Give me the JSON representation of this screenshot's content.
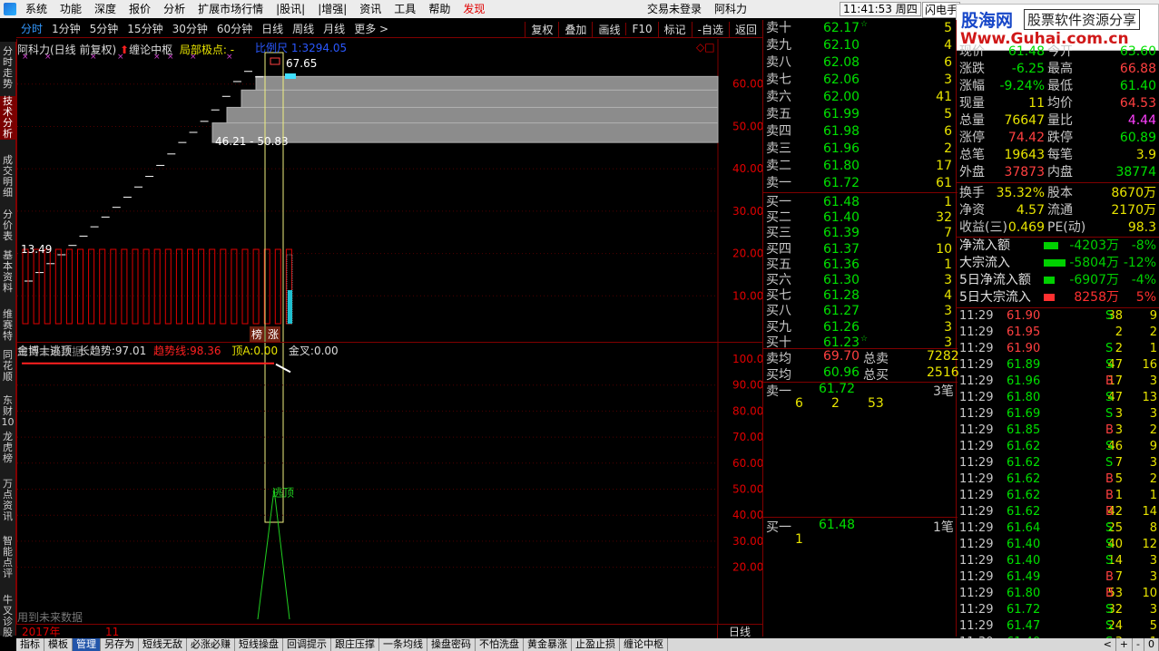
{
  "menu": {
    "items": [
      "系统",
      "功能",
      "深度",
      "报价",
      "分析",
      "扩展市场行情",
      "|股讯|",
      "|增强|",
      "资讯",
      "工具",
      "帮助"
    ],
    "discover": "发现",
    "login_status": "交易未登录",
    "stock_name": "阿科力",
    "clock": "11:41:53 周四",
    "flash_btn": "闪电手"
  },
  "watermark": {
    "brand": "股海网",
    "slogan": "股票软件资源分享",
    "url": "Www.Guhai.com.cn"
  },
  "periods": [
    "分时",
    "1分钟",
    "5分钟",
    "15分钟",
    "30分钟",
    "60分钟",
    "日线",
    "周线",
    "月线",
    "更多 >"
  ],
  "period_selected": 0,
  "tools": [
    "复权",
    "叠加",
    "画线",
    "F10",
    "标记",
    "-自选",
    "返回"
  ],
  "left_tabs": [
    "分时走势",
    "技术分析",
    "成交明细",
    "分价表",
    "基本资料",
    "维赛特",
    "同花顺",
    "东财10",
    "龙虎榜",
    "万点资讯",
    "智能点评",
    "牛叉诊股"
  ],
  "left_tab_selected": 1,
  "main_chart": {
    "title": "阿科力(日线 前复权)",
    "indicator": "缠论中枢",
    "extra_label": "局部极点: -",
    "header_blue": "比例尺 1:3294.05",
    "high_label": "67.65",
    "range_label": "46.21 - 50.83",
    "low_label": "13.49",
    "future_data_note": "用到未来数据",
    "badges": [
      "榜",
      "涨"
    ],
    "y_ticks": [
      "60.00",
      "50.00",
      "40.00",
      "30.00",
      "20.00",
      "10.00"
    ]
  },
  "chart_data": {
    "type": "bar",
    "step_prices": [
      13.49,
      15.5,
      17.6,
      19.7,
      21.9,
      24.1,
      26.3,
      28.6,
      30.9,
      33.3,
      35.7,
      38.2,
      40.8,
      43.5,
      46.21,
      48.6,
      51.2,
      53.9,
      57.1,
      60.6,
      63.0,
      61.7
    ],
    "volume_bars": 25,
    "zhongshu_zones": [
      [
        46.21,
        50.83
      ],
      [
        50.83,
        54.5
      ],
      [
        54.5,
        58.6
      ],
      [
        58.6,
        61.8
      ]
    ],
    "y_range": [
      0,
      67.65
    ]
  },
  "sub_chart": {
    "title": "金博士逃顶",
    "long_trend_label": "长趋势:",
    "long_trend_value": "97.01",
    "trend_line_label": "趋势线:",
    "trend_line_value": "98.36",
    "top_a_label": "顶A:",
    "top_a_value": "0.00",
    "golden_cross_label": "金叉:",
    "golden_cross_value": "0.00",
    "escape_label": "逃顶",
    "future_data_note": "用到未来数据",
    "y_ticks": [
      "100.0",
      "90.00",
      "80.00",
      "70.00",
      "60.00",
      "50.00",
      "40.00",
      "30.00",
      "20.00"
    ],
    "spike_value": 50
  },
  "date_bar": {
    "year": "2017年",
    "month": "11",
    "period": "日线"
  },
  "order_book": {
    "asks": [
      {
        "label": "卖十",
        "price": "62.17",
        "vol": "5",
        "flag": "☆"
      },
      {
        "label": "卖九",
        "price": "62.10",
        "vol": "4",
        "flag": ""
      },
      {
        "label": "卖八",
        "price": "62.08",
        "vol": "6",
        "flag": ""
      },
      {
        "label": "卖七",
        "price": "62.06",
        "vol": "3",
        "flag": ""
      },
      {
        "label": "卖六",
        "price": "62.00",
        "vol": "41",
        "flag": ""
      },
      {
        "label": "卖五",
        "price": "61.99",
        "vol": "5",
        "flag": ""
      },
      {
        "label": "卖四",
        "price": "61.98",
        "vol": "6",
        "flag": ""
      },
      {
        "label": "卖三",
        "price": "61.96",
        "vol": "2",
        "flag": ""
      },
      {
        "label": "卖二",
        "price": "61.80",
        "vol": "17",
        "flag": ""
      },
      {
        "label": "卖一",
        "price": "61.72",
        "vol": "61",
        "flag": ""
      }
    ],
    "bids": [
      {
        "label": "买一",
        "price": "61.48",
        "vol": "1",
        "flag": ""
      },
      {
        "label": "买二",
        "price": "61.40",
        "vol": "32",
        "flag": ""
      },
      {
        "label": "买三",
        "price": "61.39",
        "vol": "7",
        "flag": ""
      },
      {
        "label": "买四",
        "price": "61.37",
        "vol": "10",
        "flag": ""
      },
      {
        "label": "买五",
        "price": "61.36",
        "vol": "1",
        "flag": ""
      },
      {
        "label": "买六",
        "price": "61.30",
        "vol": "3",
        "flag": ""
      },
      {
        "label": "买七",
        "price": "61.28",
        "vol": "4",
        "flag": ""
      },
      {
        "label": "买八",
        "price": "61.27",
        "vol": "3",
        "flag": ""
      },
      {
        "label": "买九",
        "price": "61.26",
        "vol": "3",
        "flag": ""
      },
      {
        "label": "买十",
        "price": "61.23",
        "vol": "3",
        "flag": "☆"
      }
    ],
    "avg_ask_label": "卖均",
    "avg_ask": "69.70",
    "total_ask_label": "总卖",
    "total_ask": "7282",
    "avg_bid_label": "买均",
    "avg_bid": "60.96",
    "total_bid_label": "总买",
    "total_bid": "2516",
    "ask1_detail_label": "卖一",
    "ask1_detail_price": "61.72",
    "ask1_detail_count": "3笔",
    "ask1_orders": [
      "6",
      "2",
      "53"
    ],
    "bid1_detail_label": "买一",
    "bid1_detail_price": "61.48",
    "bid1_detail_count": "1笔",
    "bid1_orders": [
      "1"
    ]
  },
  "quote": {
    "top_partial": {
      "a": "现价",
      "b": "61.48",
      "c": "今开",
      "d": "63.60"
    },
    "rows": [
      {
        "a": "涨跌",
        "b": "-6.25",
        "c": "最高",
        "d": "66.88",
        "bc": "#00e000",
        "dc": "#ff4040"
      },
      {
        "a": "涨幅",
        "b": "-9.24%",
        "c": "最低",
        "d": "61.40",
        "bc": "#00e000",
        "dc": "#00e000"
      },
      {
        "a": "现量",
        "b": "11",
        "c": "均价",
        "d": "64.53",
        "bc": "#e8e400",
        "dc": "#ff4040"
      },
      {
        "a": "总量",
        "b": "76647",
        "c": "量比",
        "d": "4.44",
        "bc": "#e8e400",
        "dc": "#ff40ff"
      },
      {
        "a": "涨停",
        "b": "74.42",
        "c": "跌停",
        "d": "60.89",
        "bc": "#ff4040",
        "dc": "#00e000"
      },
      {
        "a": "总笔",
        "b": "19643",
        "c": "每笔",
        "d": "3.9",
        "bc": "#e8e400",
        "dc": "#e8e400"
      },
      {
        "a": "外盘",
        "b": "37873",
        "c": "内盘",
        "d": "38774",
        "bc": "#ff4040",
        "dc": "#00e000"
      }
    ],
    "rows2": [
      {
        "a": "换手",
        "b": "35.32%",
        "c": "股本",
        "d": "8670万",
        "bc": "#e8e400",
        "dc": "#e8e400"
      },
      {
        "a": "净资",
        "b": "4.57",
        "c": "流通",
        "d": "2170万",
        "bc": "#e8e400",
        "dc": "#e8e400"
      },
      {
        "a": "收益(三)",
        "b": "0.469",
        "c": "PE(动)",
        "d": "98.3",
        "bc": "#e8e400",
        "dc": "#e8e400"
      }
    ],
    "flows": [
      {
        "a": "净流入额",
        "b": "-4203万",
        "c": "-8%",
        "color": "#00d000",
        "fill": 0.08
      },
      {
        "a": "大宗流入",
        "b": "-5804万",
        "c": "-12%",
        "color": "#00d000",
        "fill": 0.12
      },
      {
        "a": "5日净流入额",
        "b": "-6907万",
        "c": "-4%",
        "color": "#00d000",
        "fill": 0.04
      },
      {
        "a": "5日大宗流入",
        "b": "8258万",
        "c": "5%",
        "color": "#ff3030",
        "fill": 0.05
      }
    ],
    "ticks": [
      {
        "t": "11:29",
        "p": "61.90",
        "v": "38",
        "s": "S",
        "n": "9",
        "pc": "#ff4040"
      },
      {
        "t": "11:29",
        "p": "61.95",
        "v": "2",
        "s": "",
        "n": "2",
        "pc": "#ff4040"
      },
      {
        "t": "11:29",
        "p": "61.90",
        "v": "2",
        "s": "S",
        "n": "1",
        "pc": "#ff4040"
      },
      {
        "t": "11:29",
        "p": "61.89",
        "v": "47",
        "s": "S",
        "n": "16",
        "pc": "#00e000"
      },
      {
        "t": "11:29",
        "p": "61.96",
        "v": "17",
        "s": "B",
        "n": "3",
        "pc": "#00e000"
      },
      {
        "t": "11:29",
        "p": "61.80",
        "v": "47",
        "s": "S",
        "n": "13",
        "pc": "#00e000"
      },
      {
        "t": "11:29",
        "p": "61.69",
        "v": "3",
        "s": "S",
        "n": "3",
        "pc": "#00e000"
      },
      {
        "t": "11:29",
        "p": "61.85",
        "v": "3",
        "s": "B",
        "n": "2",
        "pc": "#00e000"
      },
      {
        "t": "11:29",
        "p": "61.62",
        "v": "46",
        "s": "S",
        "n": "9",
        "pc": "#00e000"
      },
      {
        "t": "11:29",
        "p": "61.62",
        "v": "7",
        "s": "S",
        "n": "3",
        "pc": "#00e000"
      },
      {
        "t": "11:29",
        "p": "61.62",
        "v": "5",
        "s": "B",
        "n": "2",
        "pc": "#00e000"
      },
      {
        "t": "11:29",
        "p": "61.62",
        "v": "1",
        "s": "B",
        "n": "1",
        "pc": "#00e000"
      },
      {
        "t": "11:29",
        "p": "61.62",
        "v": "42",
        "s": "B",
        "n": "14",
        "pc": "#00e000"
      },
      {
        "t": "11:29",
        "p": "61.64",
        "v": "25",
        "s": "S",
        "n": "8",
        "pc": "#00e000"
      },
      {
        "t": "11:29",
        "p": "61.40",
        "v": "40",
        "s": "S",
        "n": "12",
        "pc": "#00e000"
      },
      {
        "t": "11:29",
        "p": "61.40",
        "v": "14",
        "s": "S",
        "n": "3",
        "pc": "#00e000"
      },
      {
        "t": "11:29",
        "p": "61.49",
        "v": "7",
        "s": "B",
        "n": "3",
        "pc": "#00e000"
      },
      {
        "t": "11:29",
        "p": "61.80",
        "v": "53",
        "s": "B",
        "n": "10",
        "pc": "#00e000"
      },
      {
        "t": "11:29",
        "p": "61.72",
        "v": "32",
        "s": "S",
        "n": "3",
        "pc": "#00e000"
      },
      {
        "t": "11:29",
        "p": "61.47",
        "v": "24",
        "s": "S",
        "n": "5",
        "pc": "#00e000"
      },
      {
        "t": "11:30",
        "p": "61.40",
        "v": "3",
        "s": "S",
        "n": "1",
        "pc": "#00e000"
      }
    ]
  },
  "bottom_tabs": [
    "指标",
    "模板",
    "管理",
    "另存为",
    "短线无敌",
    "必涨必赚",
    "短线操盘",
    "回调提示",
    "跟庄压撑",
    "一条均线",
    "操盘密码",
    "不怕洗盘",
    "黄金暴涨",
    "止盈止损",
    "缠论中枢"
  ],
  "bottom_tab_selected": 2,
  "bottom_nav": [
    "<",
    "+",
    "-",
    "0"
  ],
  "colors": {
    "up": "#ff4040",
    "down": "#00e000",
    "volume": "#e8e400",
    "border": "#800000"
  }
}
